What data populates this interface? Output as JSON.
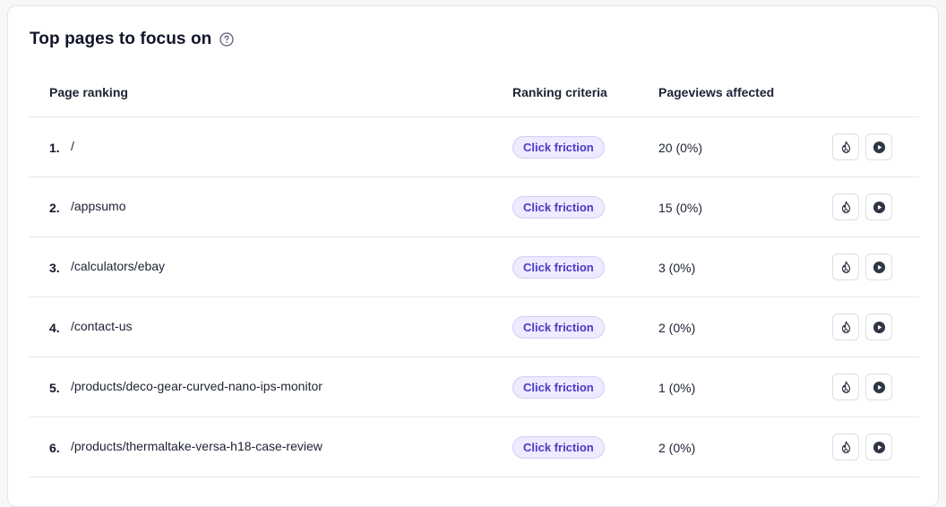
{
  "panel": {
    "title": "Top pages to focus on",
    "help_icon": "question-circle-icon"
  },
  "table": {
    "headers": {
      "page_ranking": "Page ranking",
      "ranking_criteria": "Ranking criteria",
      "pageviews_affected": "Pageviews affected"
    },
    "rows": [
      {
        "rank": "1.",
        "page": "/",
        "criteria": "Click friction",
        "pageviews": "20 (0%)"
      },
      {
        "rank": "2.",
        "page": "/appsumo",
        "criteria": "Click friction",
        "pageviews": "15 (0%)"
      },
      {
        "rank": "3.",
        "page": "/calculators/ebay",
        "criteria": "Click friction",
        "pageviews": "3 (0%)"
      },
      {
        "rank": "4.",
        "page": "/contact-us",
        "criteria": "Click friction",
        "pageviews": "2 (0%)"
      },
      {
        "rank": "5.",
        "page": "/products/deco-gear-curved-nano-ips-monitor",
        "criteria": "Click friction",
        "pageviews": "1 (0%)"
      },
      {
        "rank": "6.",
        "page": "/products/thermaltake-versa-h18-case-review",
        "criteria": "Click friction",
        "pageviews": "2 (0%)"
      }
    ],
    "row_actions": {
      "heatmap_icon": "flame-icon",
      "recording_icon": "play-circle-icon"
    }
  },
  "colors": {
    "badge_text": "#4b3bc5",
    "badge_bg": "#eeeaff",
    "badge_border": "#d5cdf7",
    "heading_text": "#11162a"
  }
}
